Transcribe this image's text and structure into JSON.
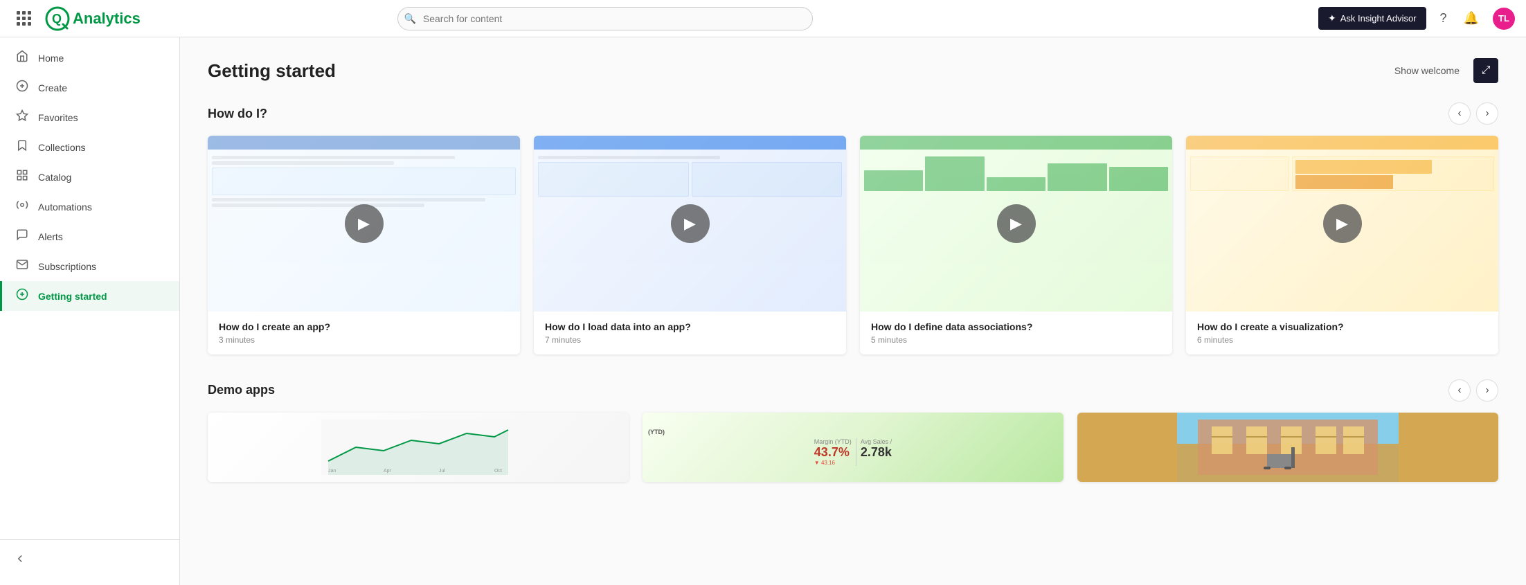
{
  "app": {
    "title": "Analytics"
  },
  "navbar": {
    "search_placeholder": "Search for content",
    "insight_advisor_label": "Ask Insight Advisor",
    "avatar_initials": "TL"
  },
  "sidebar": {
    "items": [
      {
        "id": "home",
        "label": "Home",
        "icon": "🏠"
      },
      {
        "id": "create",
        "label": "Create",
        "icon": "+"
      },
      {
        "id": "favorites",
        "label": "Favorites",
        "icon": "☆"
      },
      {
        "id": "collections",
        "label": "Collections",
        "icon": "🔖"
      },
      {
        "id": "catalog",
        "label": "Catalog",
        "icon": "📋"
      },
      {
        "id": "automations",
        "label": "Automations",
        "icon": "⚙"
      },
      {
        "id": "alerts",
        "label": "Alerts",
        "icon": "🔔"
      },
      {
        "id": "subscriptions",
        "label": "Subscriptions",
        "icon": "✉"
      },
      {
        "id": "getting-started",
        "label": "Getting started",
        "icon": "🚀",
        "active": true
      }
    ],
    "collapse_label": ""
  },
  "main": {
    "page_title": "Getting started",
    "show_welcome_label": "Show welcome",
    "how_do_i_section": {
      "title": "How do I?",
      "videos": [
        {
          "title": "How do I create an app?",
          "duration": "3 minutes"
        },
        {
          "title": "How do I load data into an app?",
          "duration": "7 minutes"
        },
        {
          "title": "How do I define data associations?",
          "duration": "5 minutes"
        },
        {
          "title": "How do I create a visualization?",
          "duration": "6 minutes"
        }
      ]
    },
    "demo_apps_section": {
      "title": "Demo apps",
      "apps": [
        {
          "id": "app1",
          "type": "chart"
        },
        {
          "id": "app2",
          "type": "kpi"
        },
        {
          "id": "app3",
          "type": "warehouse"
        }
      ]
    }
  }
}
